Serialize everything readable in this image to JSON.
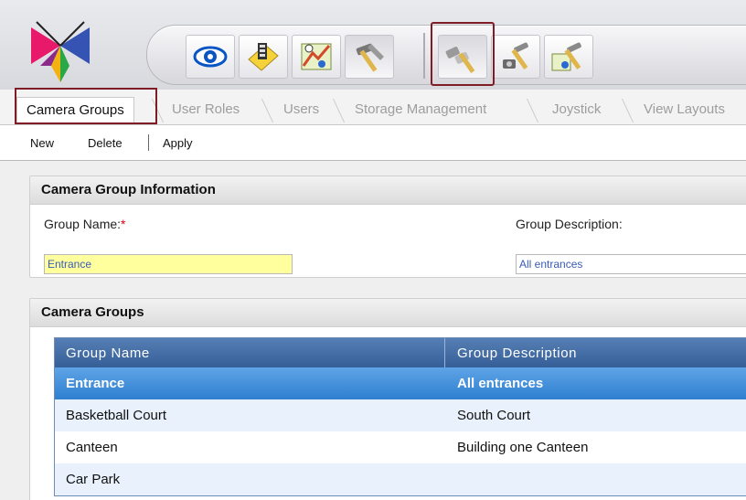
{
  "colors": {
    "accent": "#7e1d25",
    "selected_row": "#2e7fd0",
    "grid_header": "#365f98"
  },
  "toolbar": {
    "buttons": [
      {
        "name": "eye-icon"
      },
      {
        "name": "film-tag-icon"
      },
      {
        "name": "map-icon"
      },
      {
        "name": "hammer-tools-icon"
      },
      {
        "name": "camera-group-tools-icon"
      },
      {
        "name": "camera-tools-icon"
      },
      {
        "name": "map-tools-icon"
      }
    ]
  },
  "tabs": {
    "items": [
      {
        "label": "Camera Groups"
      },
      {
        "label": "User Roles"
      },
      {
        "label": "Users"
      },
      {
        "label": "Storage Management"
      },
      {
        "label": "Joystick"
      },
      {
        "label": "View Layouts"
      }
    ]
  },
  "commands": {
    "new": "New",
    "delete": "Delete",
    "apply": "Apply"
  },
  "info_panel": {
    "title": "Camera Group Information",
    "group_name_label": "Group Name:",
    "required_mark": "*",
    "group_name_value": "Entrance",
    "group_desc_label": "Group Description:",
    "group_desc_value": "All entrances"
  },
  "groups_panel": {
    "title": "Camera Groups",
    "columns": [
      "Group Name",
      "Group Description"
    ],
    "rows": [
      {
        "name": "Entrance",
        "description": "All entrances"
      },
      {
        "name": "Basketball Court",
        "description": "South Court"
      },
      {
        "name": "Canteen",
        "description": "Building one Canteen"
      },
      {
        "name": "Car Park",
        "description": ""
      }
    ]
  }
}
